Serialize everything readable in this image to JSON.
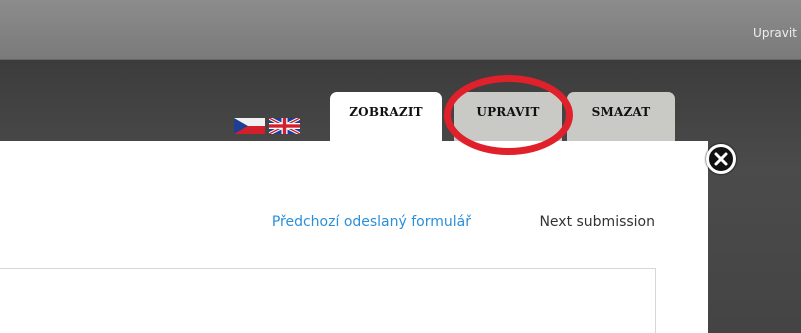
{
  "header": {
    "right_link": "Upravit z"
  },
  "languages": [
    {
      "icon": "czech-flag-icon"
    },
    {
      "icon": "uk-flag-icon"
    }
  ],
  "tabs": {
    "view": "ZOBRAZIT",
    "edit": "UPRAVIT",
    "delete": "SMAZAT"
  },
  "submission_nav": {
    "previous": "Předchozí odeslaný formulář",
    "next": "Next submission"
  },
  "colors": {
    "link": "#2a8fd8",
    "highlight": "#e0202a",
    "active_tab": "#ffffff",
    "inactive_tab": "#c9c9c6"
  },
  "icons": {
    "close": "close-icon"
  }
}
